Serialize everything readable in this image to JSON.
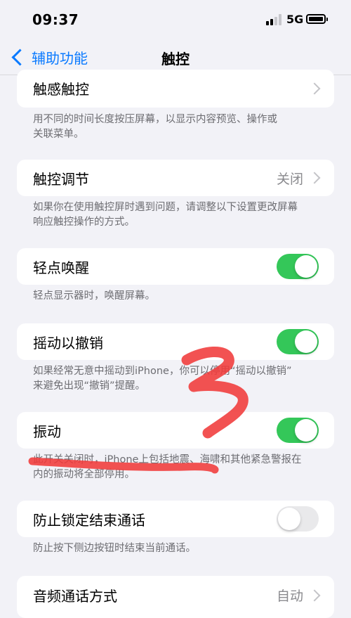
{
  "status_bar": {
    "time": "09:37",
    "network": "5G"
  },
  "nav": {
    "back_label": "辅助功能",
    "title": "触控"
  },
  "sections": {
    "haptic_touch": {
      "label": "触感触控",
      "footer_line1": "用不同的时间长度按压屏幕，以显示内容预览、操作或",
      "footer_line2": "关联菜单。"
    },
    "touch_accommodations": {
      "label": "触控调节",
      "value": "关闭",
      "footer_line1": "如果你在使用触控屏时遇到问题，请调整以下设置更改屏幕",
      "footer_line2": "响应触控操作的方式。"
    },
    "tap_to_wake": {
      "label": "轻点唤醒",
      "enabled": true,
      "footer_line1": "轻点显示器时，唤醒屏幕。"
    },
    "shake_to_undo": {
      "label": "摇动以撤销",
      "enabled": true,
      "footer_line1": "如果经常无意中摇动到iPhone，你可以停用“摇动以撤销”",
      "footer_line2": "来避免出现“撤销”提醒。"
    },
    "vibration": {
      "label": "振动",
      "enabled": true,
      "footer_line1": "此开关关闭时，iPhone上包括地震、海啸和其他紧急警报在",
      "footer_line2": "内的振动将全部停用。"
    },
    "prevent_lock_end_call": {
      "label": "防止锁定结束通话",
      "enabled": false,
      "footer_line1": "防止按下侧边按钮时结束当前通话。"
    },
    "call_audio_routing": {
      "label": "音频通话方式",
      "value": "自动"
    }
  },
  "colors": {
    "accent": "#0a7aff",
    "toggle_on": "#34c759",
    "toggle_off": "#e9e9eb",
    "background": "#f2f2f7",
    "scribble": "#f03a3a"
  },
  "icons": [
    "chevron-left-icon",
    "chevron-right-icon",
    "signal-icon",
    "battery-icon"
  ]
}
